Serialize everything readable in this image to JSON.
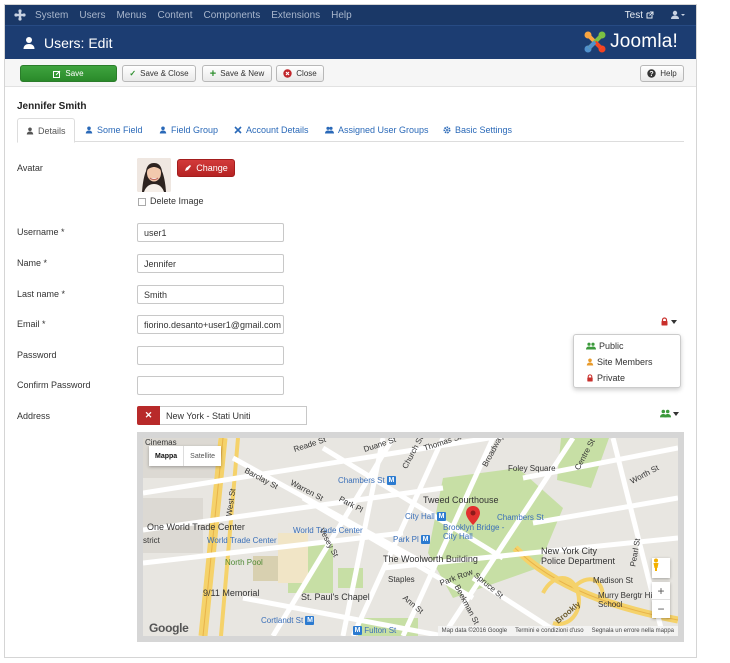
{
  "topnav": {
    "menu": [
      "System",
      "Users",
      "Menus",
      "Content",
      "Components",
      "Extensions",
      "Help"
    ],
    "site_link": "Test"
  },
  "header": {
    "title": "Users: Edit",
    "brand": "Joomla!"
  },
  "toolbar": {
    "save": "Save",
    "save_close": "Save & Close",
    "save_new": "Save & New",
    "close": "Close",
    "help": "Help"
  },
  "user": {
    "display_name": "Jennifer Smith"
  },
  "tabs": [
    "Details",
    "Some Field",
    "Field Group",
    "Account Details",
    "Assigned User Groups",
    "Basic Settings"
  ],
  "form": {
    "avatar_label": "Avatar",
    "change_button": "Change",
    "delete_image": "Delete Image",
    "username_label": "Username *",
    "username_value": "user1",
    "name_label": "Name *",
    "name_value": "Jennifer",
    "lastname_label": "Last name *",
    "lastname_value": "Smith",
    "email_label": "Email *",
    "email_value": "fiorino.desanto+user1@gmail.com",
    "password_label": "Password",
    "confirm_label": "Confirm Password",
    "address_label": "Address",
    "address_value": "New York - Stati Uniti"
  },
  "privacy_menu": {
    "options": [
      "Public",
      "Site Members",
      "Private"
    ]
  },
  "colors": {
    "nav_bg": "#1a3867",
    "header_bg": "#1c3d72",
    "save_green": "#2a8a2a",
    "danger_red": "#b82a2a",
    "link_blue": "#2a69b8"
  },
  "map": {
    "type_buttons": [
      "Mappa",
      "Satellite"
    ],
    "labels": {
      "cinemas": "Cinemas",
      "barclay": "Barclay St",
      "west_st": "West St",
      "chambers1": "Chambers St",
      "chambers2": "Chambers St",
      "foley": "Foley Square",
      "worth": "Worth St",
      "tweed": "Tweed Courthouse",
      "city_hall": "City Hall",
      "brooklyn_bridge": "Brooklyn Bridge - City Hall",
      "owtc": "One World Trade Center",
      "wtc": "World Trade Center",
      "park_pl": "Park Pl",
      "woolworth": "The Woolworth Building",
      "nyc_police": "New York City Police Department",
      "north_pool": "North Pool",
      "staples": "Staples",
      "park_row": "Park Row",
      "memorial": "9/11 Memorial",
      "st_pauls": "St. Paul's Chapel",
      "cortlandt": "Cortlandt St",
      "fulton": "Fulton St",
      "madison": "Madison St",
      "murry": "Murry Bergtr High School",
      "district": "strict",
      "church": "Church St",
      "broadway": "Broadway",
      "vesey": "Vesey St",
      "park_pl_road": "Park Pl",
      "ann": "Ann St",
      "spruce": "Spruce St",
      "beekman": "Beekman St",
      "pearl": "Pearl St",
      "centre": "Centre St",
      "brooklyn_road": "Brookly",
      "duane": "Duane St",
      "reade": "Reade St",
      "thomas": "Thomas St",
      "warren": "Warren St"
    },
    "attribution": [
      "Map data ©2016 Google",
      "Termini e condizioni d'uso",
      "Segnala un errore nella mappa"
    ],
    "google": "Google",
    "zoom_in": "+",
    "zoom_out": "−"
  }
}
